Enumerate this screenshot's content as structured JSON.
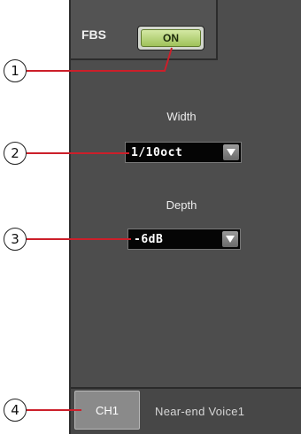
{
  "fbs": {
    "label": "FBS",
    "toggle_label": "ON",
    "toggle_state": "on"
  },
  "width": {
    "label": "Width",
    "value": "1/10oct"
  },
  "depth": {
    "label": "Depth",
    "value": "-6dB"
  },
  "channel": {
    "button_label": "CH1",
    "name": "Near-end Voice1"
  },
  "callouts": [
    "1",
    "2",
    "3",
    "4"
  ],
  "colors": {
    "panel": "#4d4d4d",
    "on_button": "#b7d47a",
    "leader_line": "#cc1f2a"
  },
  "icons": {
    "dropdown_arrow": "triangle-down"
  }
}
